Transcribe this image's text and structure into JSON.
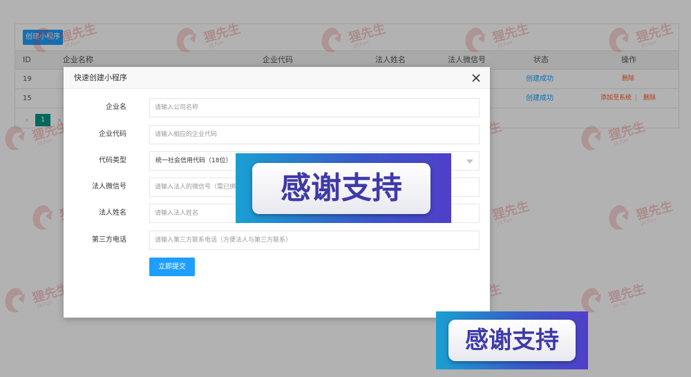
{
  "toolbar": {
    "create_label": "创建小程序"
  },
  "table": {
    "headers": [
      "ID",
      "企业名称",
      "企业代码",
      "法人姓名",
      "法人微信号",
      "状态",
      "操作"
    ],
    "rows": [
      {
        "id": "19",
        "status": "创建成功",
        "ops": [
          "删除"
        ]
      },
      {
        "id": "15",
        "status": "创建成功",
        "ops": [
          "添加至系统",
          "删除"
        ],
        "sep": "|"
      }
    ]
  },
  "pagination": {
    "prev": "‹",
    "current": "1",
    "next": "›"
  },
  "watermark": {
    "text": "狸先生",
    "sub": "Jit.Fun"
  },
  "modal": {
    "title": "快速创建小程序",
    "close_icon": "close-icon",
    "fields": [
      {
        "label": "企业名",
        "placeholder": "请输入公司名称"
      },
      {
        "label": "企业代码",
        "placeholder": "请输入相应的企业代码"
      },
      {
        "label": "代码类型",
        "value": "统一社会信用代码（18位）"
      },
      {
        "label": "法人微信号",
        "placeholder": "请输入法人的微信号（需已绑定"
      },
      {
        "label": "法人姓名",
        "placeholder": "请输入法人姓名"
      },
      {
        "label": "第三方电话",
        "placeholder": "请输入第三方联系电话（方便法人与第三方联系）"
      }
    ],
    "submit_label": "立即提交"
  },
  "banner": {
    "text": "感谢支持"
  },
  "colors": {
    "primary": "#1e9fff",
    "pager": "#009688",
    "danger": "#ff5722",
    "watermark": "#e63c3c"
  }
}
